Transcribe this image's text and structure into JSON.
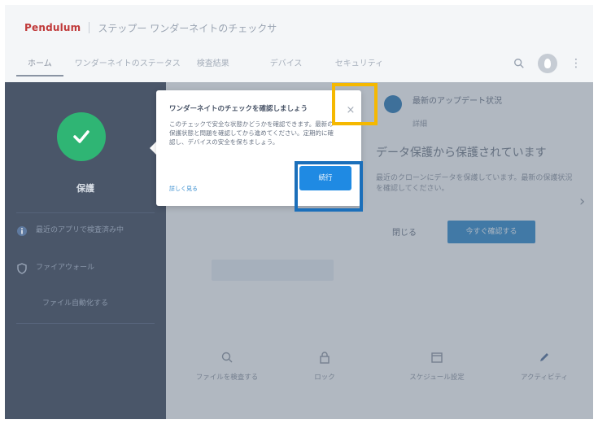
{
  "header": {
    "logo": "Pendulum",
    "page_title": "ステップー ワンダーネイトのチェックサ",
    "tabs": [
      {
        "label": "ホーム",
        "active": true
      },
      {
        "label": "ワンダーネイトのステータス",
        "active": false
      },
      {
        "label": "検査結果",
        "active": false
      },
      {
        "label": "デバイス",
        "active": false
      },
      {
        "label": "セキュリティ",
        "active": false
      }
    ],
    "icons": {
      "search": "search-icon",
      "avatar": "avatar-icon",
      "more": "more-vert-icon"
    }
  },
  "sidebar": {
    "status_icon": "check-icon",
    "status_label": "保護",
    "items": [
      {
        "icon": "info-icon",
        "label": "最近のアプリで検査済み中"
      },
      {
        "icon": "shield-icon",
        "label": "ファイアウォール"
      },
      {
        "icon": "",
        "label": "ファイル自動化する"
      }
    ]
  },
  "main": {
    "info_title": "最新のアップデート状況",
    "info_sub": "詳細",
    "heading": "データ保護から保護されています",
    "body": "最近のクローンにデータを保護しています。最新の保護状況を確認してください。",
    "secondary_button": "閉じる",
    "primary_button": "今すぐ確認する",
    "features": [
      {
        "icon": "search-icon",
        "label": "ファイルを検査する"
      },
      {
        "icon": "lock-icon",
        "label": "ロック"
      },
      {
        "icon": "calendar-icon",
        "label": "スケジュール設定"
      },
      {
        "icon": "pen-icon",
        "label": "アクティビティ"
      }
    ]
  },
  "dialog": {
    "title": "ワンダーネイトのチェックを確認しましょう",
    "body": "このチェックで安全な状態かどうかを確認できます。最新の保護状態と問題を確認してから進めてください。定期的に確認し、デバイスの安全を保ちましょう。",
    "link": "詳しく見る",
    "close_symbol": "×",
    "action_button": "続行"
  },
  "colors": {
    "brand": "#c03a3a",
    "success": "#2fb574",
    "primary": "#1f8ae3",
    "highlight_close": "#f5b800",
    "highlight_action": "#1b6fba"
  }
}
